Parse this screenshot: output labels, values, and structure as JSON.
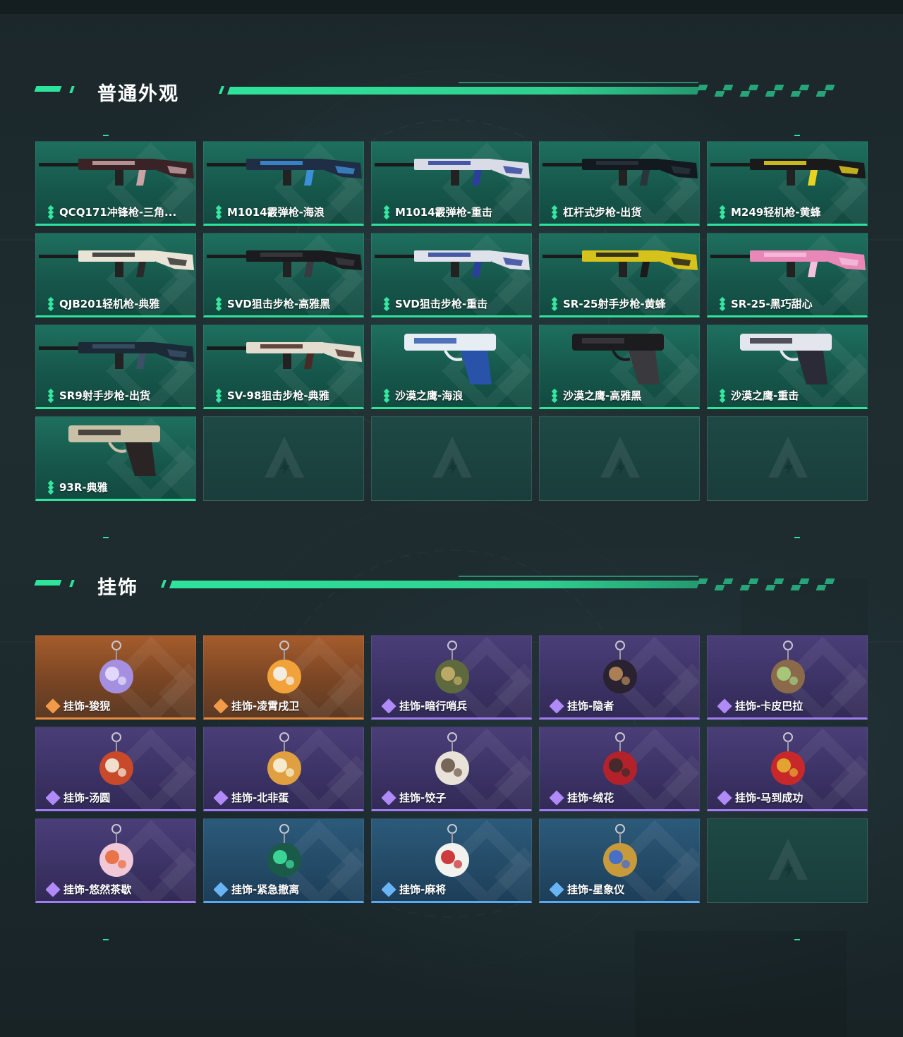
{
  "sections": [
    {
      "title": "普通外观",
      "items": [
        {
          "label": "QCQ171冲锋枪-三角...",
          "rarity": "green",
          "icon": "smg-qcq171-icon"
        },
        {
          "label": "M1014霰弹枪-海浪",
          "rarity": "green",
          "icon": "shotgun-m1014-wave-icon"
        },
        {
          "label": "M1014霰弹枪-重击",
          "rarity": "green",
          "icon": "shotgun-m1014-strike-icon"
        },
        {
          "label": "杠杆式步枪-出货",
          "rarity": "green",
          "icon": "lever-rifle-icon"
        },
        {
          "label": "M249轻机枪-黄蜂",
          "rarity": "green",
          "icon": "lmg-m249-icon"
        },
        {
          "label": "QJB201轻机枪-典雅",
          "rarity": "green",
          "icon": "lmg-qjb201-icon"
        },
        {
          "label": "SVD狙击步枪-高雅黑",
          "rarity": "green",
          "icon": "sniper-svd-black-icon"
        },
        {
          "label": "SVD狙击步枪-重击",
          "rarity": "green",
          "icon": "sniper-svd-strike-icon"
        },
        {
          "label": "SR-25射手步枪-黄蜂",
          "rarity": "green",
          "icon": "dmr-sr25-hornet-icon"
        },
        {
          "label": "SR-25-黑巧甜心",
          "rarity": "green",
          "icon": "dmr-sr25-pink-icon"
        },
        {
          "label": "SR9射手步枪-出货",
          "rarity": "green",
          "icon": "dmr-sr9-icon"
        },
        {
          "label": "SV-98狙击步枪-典雅",
          "rarity": "green",
          "icon": "sniper-sv98-icon"
        },
        {
          "label": "沙漠之鹰-海浪",
          "rarity": "green",
          "icon": "pistol-deagle-wave-icon"
        },
        {
          "label": "沙漠之鹰-高雅黑",
          "rarity": "green",
          "icon": "pistol-deagle-black-icon"
        },
        {
          "label": "沙漠之鹰-重击",
          "rarity": "green",
          "icon": "pistol-deagle-strike-icon"
        },
        {
          "label": "93R-典雅",
          "rarity": "green",
          "icon": "pistol-93r-icon"
        },
        null,
        null,
        null,
        null
      ]
    },
    {
      "title": "挂饰",
      "items": [
        {
          "label": "挂饰-狻猊",
          "rarity": "orange",
          "icon": "charm-lion-icon"
        },
        {
          "label": "挂饰-凌霄戌卫",
          "rarity": "orange",
          "icon": "charm-guardian-icon"
        },
        {
          "label": "挂饰-暗行哨兵",
          "rarity": "purple",
          "icon": "charm-sentinel-icon"
        },
        {
          "label": "挂饰-隐者",
          "rarity": "purple",
          "icon": "charm-hermit-card-icon"
        },
        {
          "label": "挂饰-卡皮巴拉",
          "rarity": "purple",
          "icon": "charm-capybara-icon"
        },
        {
          "label": "挂饰-汤圆",
          "rarity": "purple",
          "icon": "charm-tangyuan-icon"
        },
        {
          "label": "挂饰-北非蛋",
          "rarity": "purple",
          "icon": "charm-shakshuka-icon"
        },
        {
          "label": "挂饰-饺子",
          "rarity": "purple",
          "icon": "charm-dumpling-icon"
        },
        {
          "label": "挂饰-绒花",
          "rarity": "purple",
          "icon": "charm-velvet-flower-icon"
        },
        {
          "label": "挂饰-马到成功",
          "rarity": "purple",
          "icon": "charm-red-horse-icon"
        },
        {
          "label": "挂饰-悠然茶歇",
          "rarity": "purple",
          "icon": "charm-cupcake-icon"
        },
        {
          "label": "挂饰-紧急撤离",
          "rarity": "blue",
          "icon": "charm-exit-sign-icon"
        },
        {
          "label": "挂饰-麻将",
          "rarity": "blue",
          "icon": "charm-mahjong-icon"
        },
        {
          "label": "挂饰-星象仪",
          "rarity": "blue",
          "icon": "charm-astrolabe-icon"
        },
        null
      ]
    }
  ],
  "colors": {
    "accent_green": "#2ee39c",
    "rarity_orange": "#e98a3e",
    "rarity_purple": "#9f7df0",
    "rarity_blue": "#5aa8f0"
  }
}
